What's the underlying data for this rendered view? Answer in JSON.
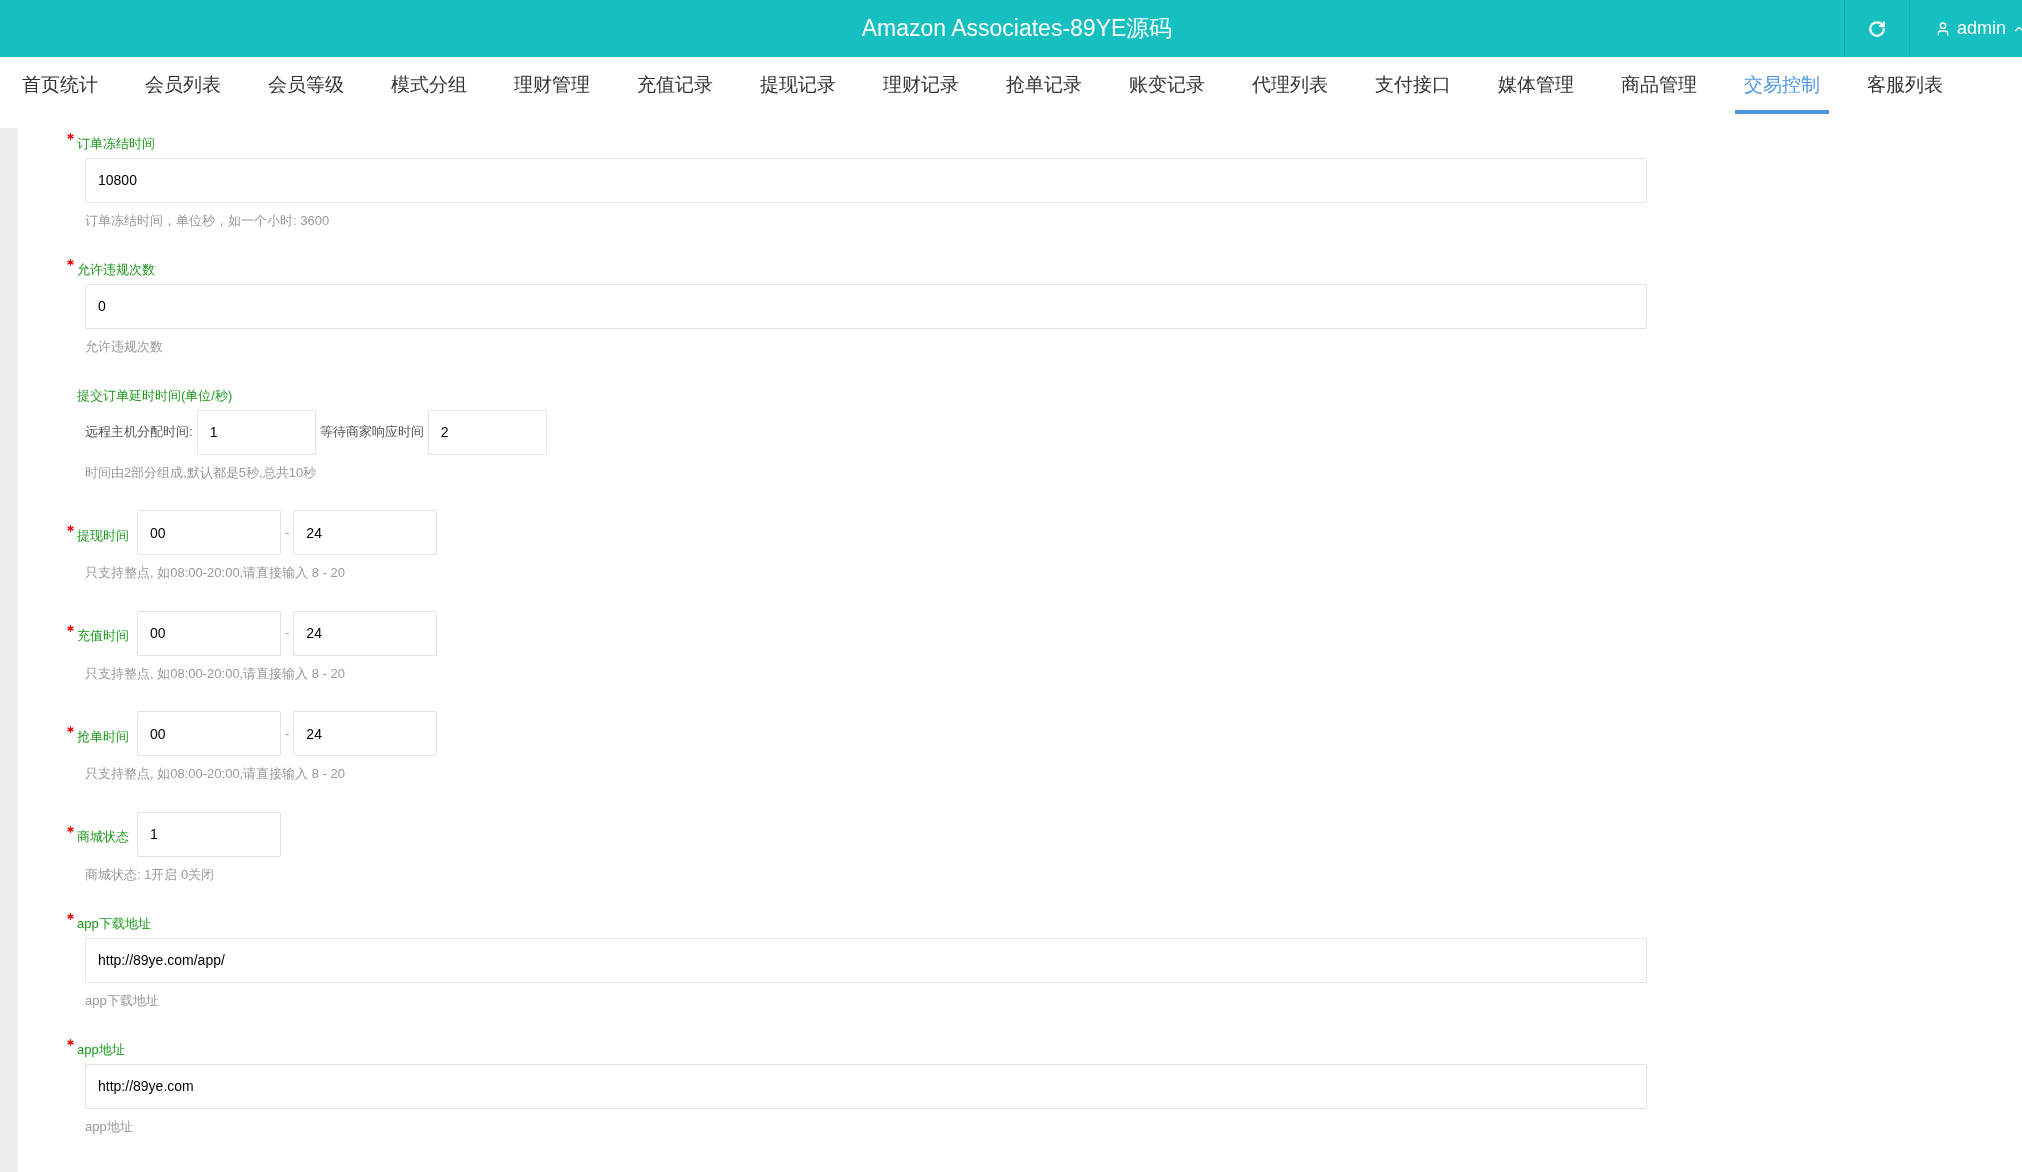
{
  "header": {
    "title": "Amazon Associates-89YE源码",
    "user": "admin"
  },
  "tabs": [
    {
      "label": "首页统计",
      "selected": false
    },
    {
      "label": "会员列表",
      "selected": false
    },
    {
      "label": "会员等级",
      "selected": false
    },
    {
      "label": "模式分组",
      "selected": false
    },
    {
      "label": "理财管理",
      "selected": false
    },
    {
      "label": "充值记录",
      "selected": false
    },
    {
      "label": "提现记录",
      "selected": false
    },
    {
      "label": "理财记录",
      "selected": false
    },
    {
      "label": "抢单记录",
      "selected": false
    },
    {
      "label": "账变记录",
      "selected": false
    },
    {
      "label": "代理列表",
      "selected": false
    },
    {
      "label": "支付接口",
      "selected": false
    },
    {
      "label": "媒体管理",
      "selected": false
    },
    {
      "label": "商品管理",
      "selected": false
    },
    {
      "label": "交易控制",
      "selected": true
    },
    {
      "label": "客服列表",
      "selected": false
    }
  ],
  "fields": [
    {
      "kind": "wide",
      "label": "订单冻结时间",
      "required": true,
      "value": "10800",
      "hint": "订单冻结时间，单位秒，如一个小时: 3600"
    },
    {
      "kind": "wide",
      "label": "允许违规次数",
      "required": true,
      "value": "0",
      "hint": "允许违规次数"
    },
    {
      "kind": "delay",
      "label": "提交订单延时时间(单位/秒)",
      "required": false,
      "first_label": "远程主机分配时间:",
      "first_value": "1",
      "second_label": "等待商家响应时间",
      "second_value": "2",
      "hint": "时间由2部分组成,默认都是5秒,总共10秒"
    },
    {
      "kind": "range",
      "label": "提现时间",
      "required": true,
      "from": "00",
      "separator": "-",
      "to": "24",
      "hint": "只支持整点, 如08:00-20:00,请直接输入 8 - 20"
    },
    {
      "kind": "range",
      "label": "充值时间",
      "required": true,
      "from": "00",
      "separator": "-",
      "to": "24",
      "hint": "只支持整点, 如08:00-20:00,请直接输入 8 - 20"
    },
    {
      "kind": "range",
      "label": "抢单时间",
      "required": true,
      "from": "00",
      "separator": "-",
      "to": "24",
      "hint": "只支持整点, 如08:00-20:00,请直接输入 8 - 20"
    },
    {
      "kind": "inline",
      "label": "商城状态",
      "required": true,
      "value": "1",
      "hint": "商城状态: 1开启 0关闭"
    },
    {
      "kind": "wide",
      "label": "app下载地址",
      "required": true,
      "value": "http://89ye.com/app/",
      "hint": "app下载地址"
    },
    {
      "kind": "wide",
      "label": "app地址",
      "required": true,
      "value": "http://89ye.com",
      "hint": "app地址"
    }
  ]
}
